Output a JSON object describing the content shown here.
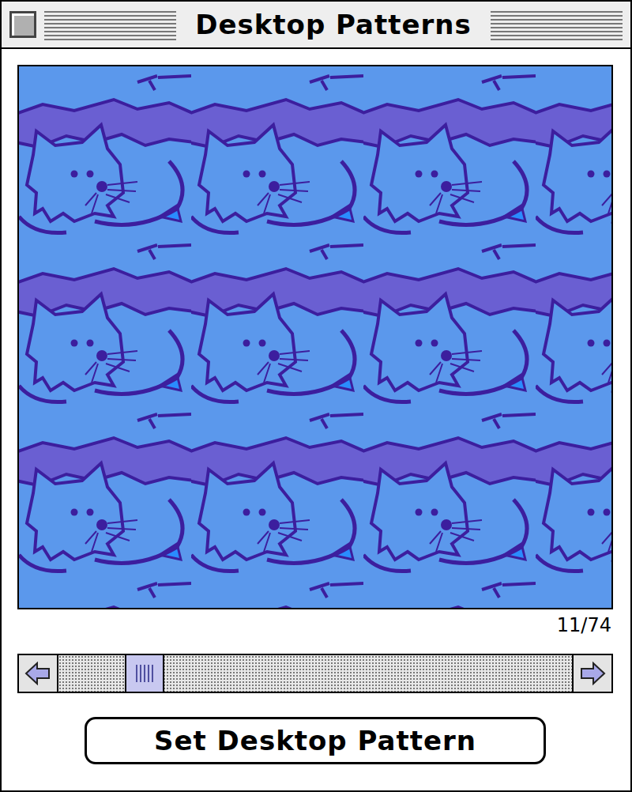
{
  "window": {
    "title": "Desktop Patterns"
  },
  "preview": {
    "counter": "11/74"
  },
  "scrollbar": {
    "level": 0.14
  },
  "button": {
    "label": "Set Desktop Pattern"
  }
}
